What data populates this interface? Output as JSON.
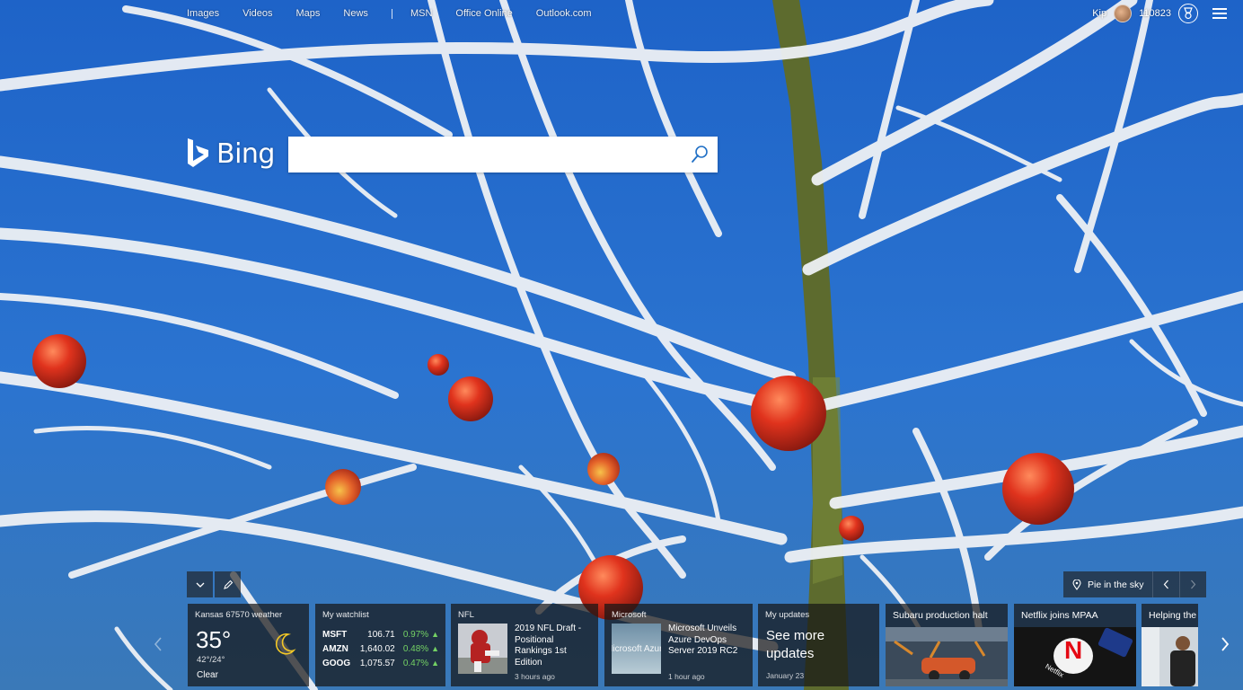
{
  "nav": {
    "items": [
      "Images",
      "Videos",
      "Maps",
      "News"
    ],
    "extra": [
      "MSN",
      "Office Online",
      "Outlook.com"
    ]
  },
  "account": {
    "username": "Kip",
    "points": "110823"
  },
  "logo": {
    "text": "Bing"
  },
  "search": {
    "value": "",
    "placeholder": ""
  },
  "image_info": {
    "location": "Pie in the sky"
  },
  "cards": {
    "weather": {
      "title": "Kansas 67570 weather",
      "temp": "35°",
      "hilo": "42°/24°",
      "condition": "Clear"
    },
    "watchlist": {
      "title": "My watchlist",
      "stocks": [
        {
          "symbol": "MSFT",
          "price": "106.71",
          "change": "0.97%"
        },
        {
          "symbol": "AMZN",
          "price": "1,640.02",
          "change": "0.48%"
        },
        {
          "symbol": "GOOG",
          "price": "1,075.57",
          "change": "0.47%"
        }
      ]
    },
    "nfl": {
      "title": "NFL",
      "headline": "2019 NFL Draft - Positional Rankings 1st Edition",
      "time": "3 hours ago"
    },
    "microsoft": {
      "title": "Microsoft",
      "headline": "Microsoft Unveils Azure DevOps Server 2019 RC2",
      "time": "1 hour ago",
      "thumb_text": "Microsoft Azure"
    },
    "updates": {
      "title": "My updates",
      "big": "See more updates",
      "date": "January 23"
    },
    "subaru": {
      "title": "Subaru production halt"
    },
    "netflix": {
      "title": "Netflix joins MPAA",
      "logo": "N",
      "word": "Netflix"
    },
    "helping": {
      "title": "Helping the f"
    }
  },
  "colors": {
    "sky": "#1f5fbf",
    "frost": "#f2f4f7",
    "apple": "#c42a1a",
    "stock_up": "#74d264",
    "card_bg": "rgba(22,22,22,0.72)"
  }
}
